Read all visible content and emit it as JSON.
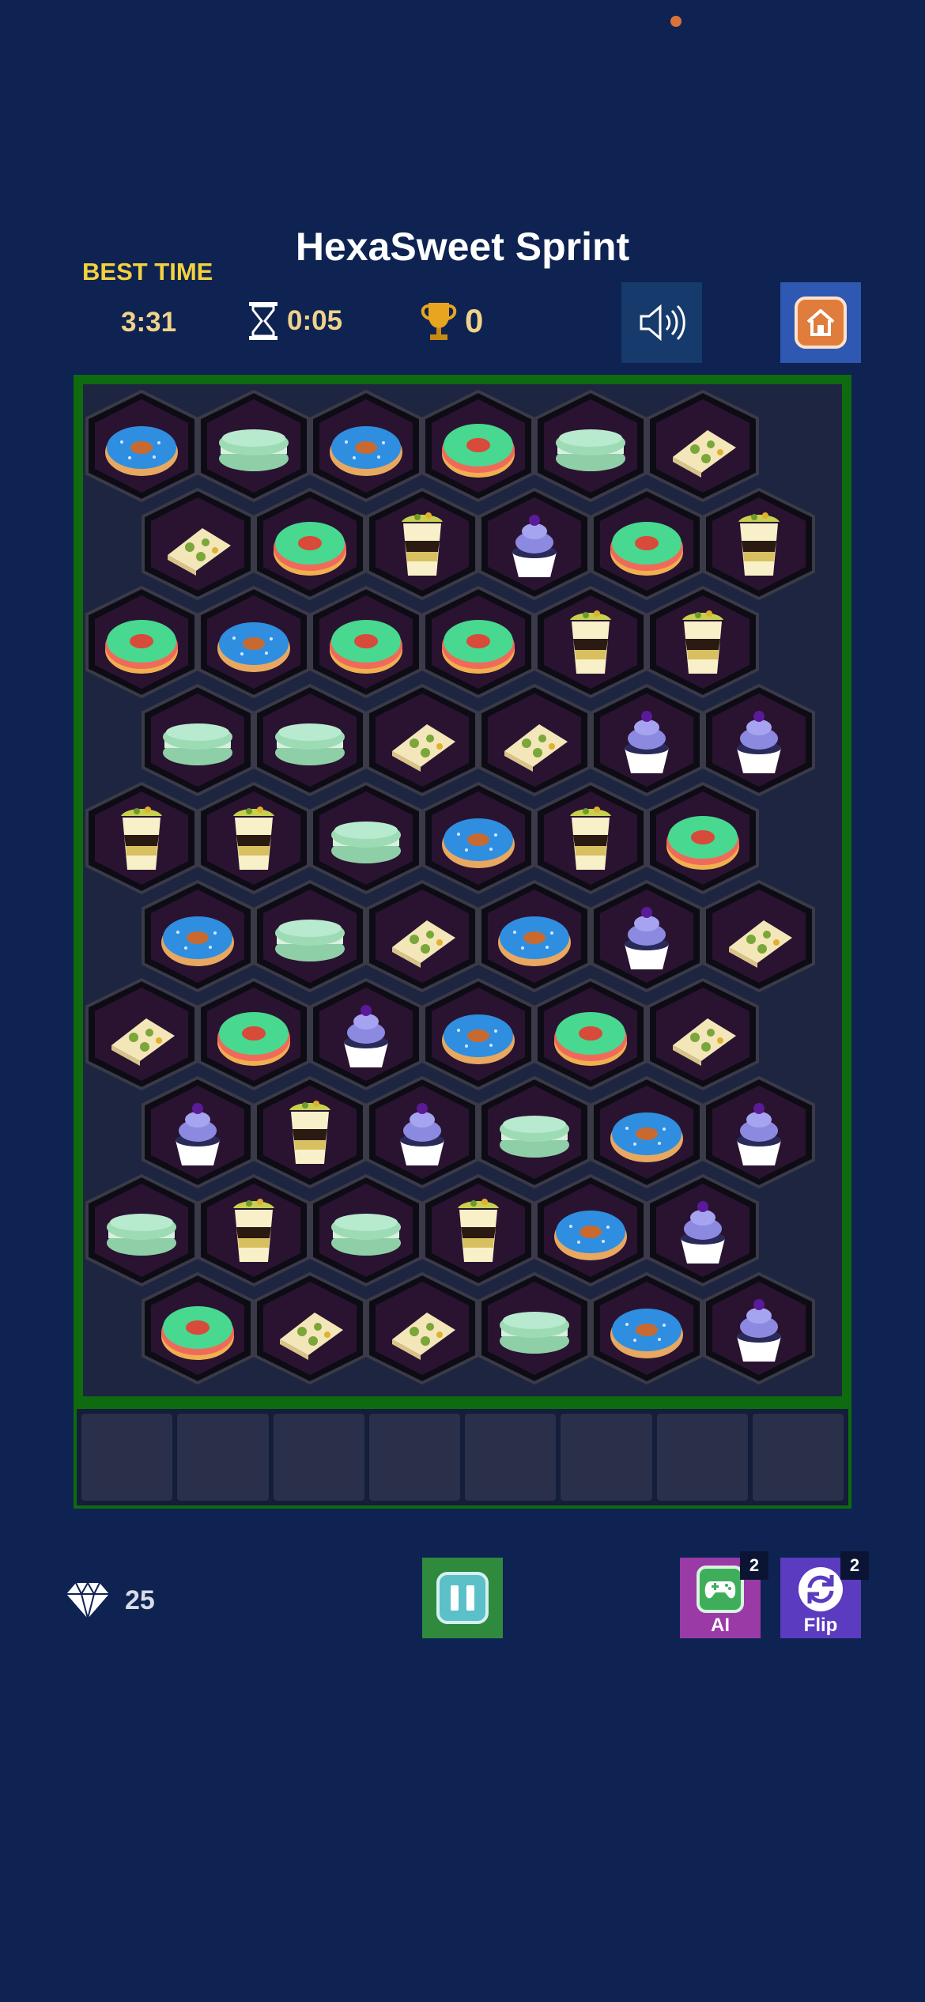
{
  "app": {
    "title": "HexaSweet Sprint"
  },
  "header": {
    "best_time_label": "BEST TIME",
    "best_time_value": "3:31",
    "timer_value": "0:05",
    "score_value": "0",
    "sound_icon": "speaker-icon",
    "home_icon": "home-icon"
  },
  "board": {
    "rows": 10,
    "cols": 6,
    "tiles": [
      [
        "donut-blue",
        "macaron-green",
        "donut-blue",
        "donut-green",
        "macaron-green",
        "waffle"
      ],
      [
        "waffle",
        "donut-green",
        "parfait",
        "cupcake",
        "donut-green",
        "parfait"
      ],
      [
        "donut-green",
        "donut-blue",
        "donut-green",
        "donut-green",
        "parfait",
        "parfait"
      ],
      [
        "macaron-green",
        "macaron-green",
        "waffle",
        "waffle",
        "cupcake",
        "cupcake"
      ],
      [
        "parfait",
        "parfait",
        "macaron-green",
        "donut-blue",
        "parfait",
        "donut-green"
      ],
      [
        "donut-blue",
        "macaron-green",
        "waffle",
        "donut-blue",
        "cupcake",
        "waffle"
      ],
      [
        "waffle",
        "donut-green",
        "cupcake",
        "donut-blue",
        "donut-green",
        "waffle"
      ],
      [
        "cupcake",
        "parfait",
        "cupcake",
        "macaron-green",
        "donut-blue",
        "cupcake"
      ],
      [
        "macaron-green",
        "parfait",
        "macaron-green",
        "parfait",
        "donut-blue",
        "cupcake"
      ],
      [
        "donut-green",
        "waffle",
        "waffle",
        "macaron-green",
        "donut-blue",
        "cupcake"
      ]
    ]
  },
  "tray": {
    "slots": 8,
    "filled": 0
  },
  "footer": {
    "gems_icon": "diamond-icon",
    "gems_count": "25",
    "pause_icon": "pause-icon",
    "ai_label": "AI",
    "ai_count": "2",
    "flip_label": "Flip",
    "flip_count": "2"
  },
  "colors": {
    "background": "#0e2352",
    "board_border": "#0f6b0f",
    "accent_yellow": "#f4d23c",
    "home_button": "#2f58b3",
    "pause_button": "#2f8a3e",
    "ai_button": "#9a3aa6",
    "flip_button": "#5b3bbf"
  }
}
